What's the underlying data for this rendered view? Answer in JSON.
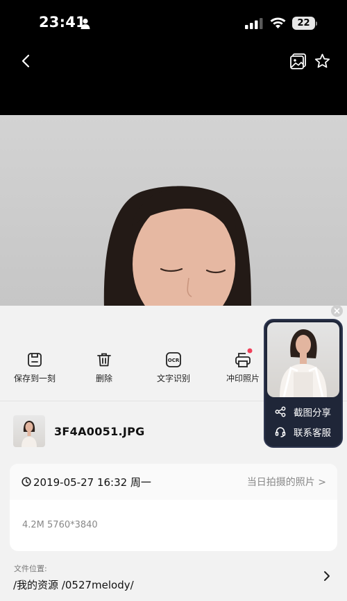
{
  "status_bar": {
    "time": "23:41",
    "battery_level": "22"
  },
  "sheet": {
    "actions": [
      {
        "label": "保存到一刻",
        "icon": "save-icon"
      },
      {
        "label": "删除",
        "icon": "trash-icon"
      },
      {
        "label": "文字识别",
        "icon": "ocr-icon"
      },
      {
        "label": "冲印照片",
        "icon": "print-icon",
        "badge_color": "#f0405a"
      }
    ],
    "file_name": "3F4A0051.JPG",
    "info": {
      "datetime": "2019-05-27 16:32 周一",
      "same_day_link": "当日拍摄的照片 >",
      "meta": "4.2M 5760*3840"
    },
    "location_label": "文件位置:",
    "location_path": "/我的资源 /0527melody/"
  },
  "share_popup": {
    "items": [
      {
        "label": "截图分享",
        "icon": "share-icon"
      },
      {
        "label": "联系客服",
        "icon": "headset-icon"
      }
    ]
  }
}
